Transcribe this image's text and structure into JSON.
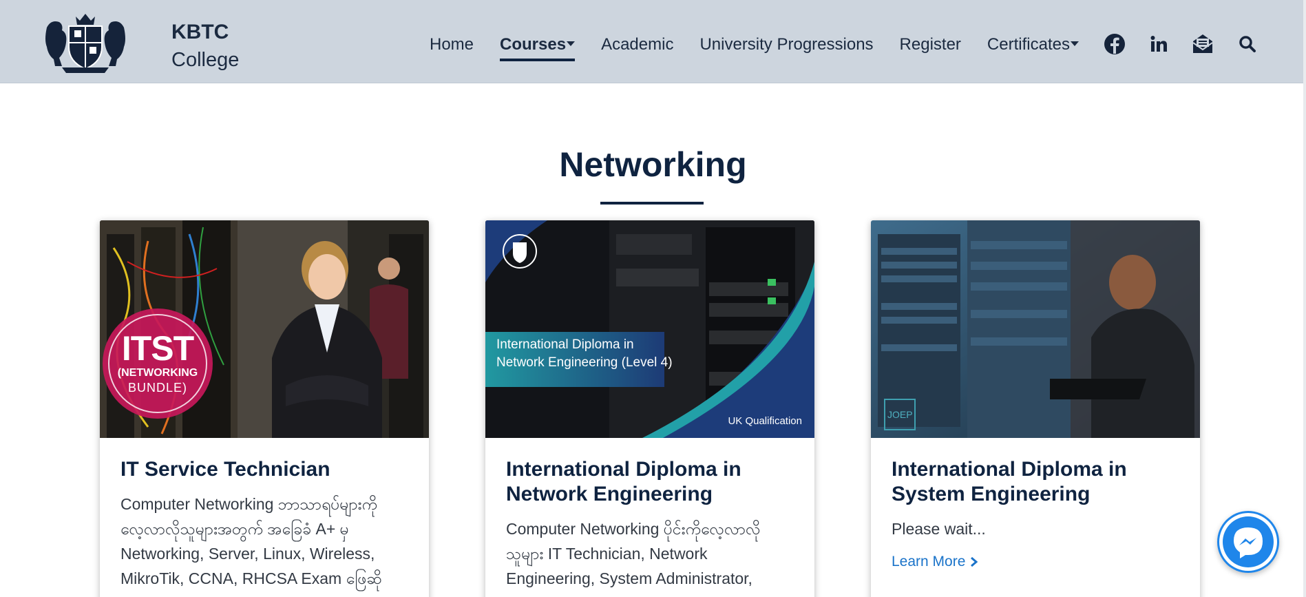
{
  "brand": {
    "title": "KBTC",
    "subtitle": "College"
  },
  "nav": [
    {
      "label": "Home",
      "dropdown": false,
      "active": false
    },
    {
      "label": "Courses",
      "dropdown": true,
      "active": true
    },
    {
      "label": "Academic",
      "dropdown": false,
      "active": false
    },
    {
      "label": "University Progressions",
      "dropdown": false,
      "active": false
    },
    {
      "label": "Register",
      "dropdown": false,
      "active": false
    },
    {
      "label": "Certificates",
      "dropdown": true,
      "active": false
    }
  ],
  "social_icons": [
    "facebook-icon",
    "linkedin-icon",
    "mail-icon",
    "search-icon"
  ],
  "section": {
    "title": "Networking"
  },
  "cards": [
    {
      "title": "IT Service Technician",
      "description": "Computer Networking ဘာသာရပ်များကို လေ့လာလိုသူများအတွက် အခြေခံ A+ မှ Networking, Server, Linux, Wireless, MikroTik, CCNA, RHCSA Exam ဖြေဆို",
      "image": {
        "badge_main": "ITST",
        "badge_line2": "(NETWORKING",
        "badge_line3": "BUNDLE)"
      }
    },
    {
      "title": "International Diploma in Network Engineering",
      "description": "Computer Networking ပိုင်းကိုလေ့လာလို သူများ IT Technician, Network Engineering, System Administrator,",
      "image": {
        "banner_line1": "International Diploma in",
        "banner_line2": "Network Engineering (Level 4)",
        "footer": "UK Qualification"
      }
    },
    {
      "title": "International Diploma in System Engineering",
      "description": "Please wait...",
      "link": "Learn More",
      "image": {
        "watermark": "JOEP"
      }
    }
  ],
  "colors": {
    "header_bg": "#cdd5de",
    "navy": "#0f2340",
    "link": "#1a73c9",
    "messenger": "#1f86ea",
    "badge_pink": "#c8185a"
  },
  "widgets": {
    "chat": "messenger-icon"
  }
}
